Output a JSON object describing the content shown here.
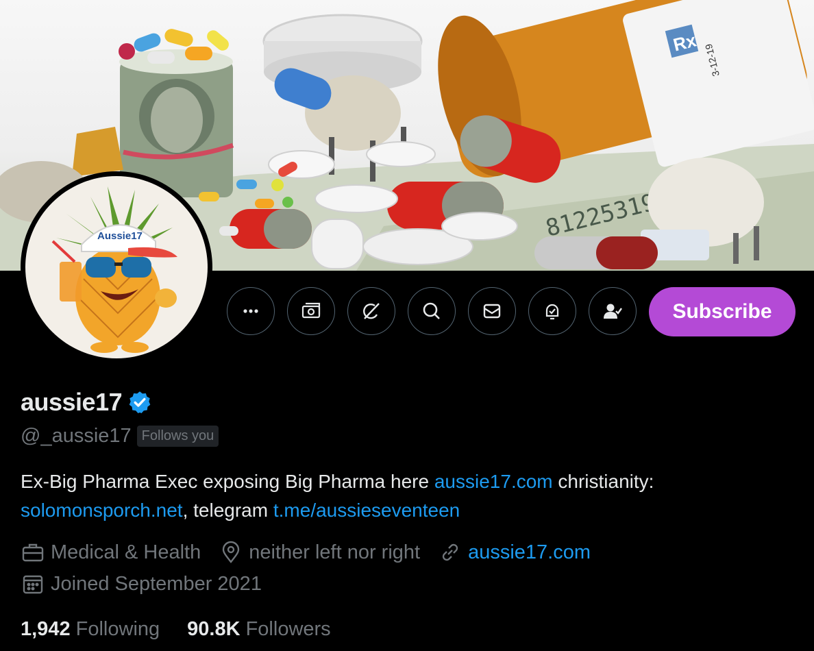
{
  "banner": {
    "label_rx": "Rx",
    "bottle_code": "3-12-19",
    "bill_serial": "81225319"
  },
  "avatar": {
    "cap_text": "Aussie17"
  },
  "actions": {
    "more_icon": "more-icon",
    "money_icon": "money-icon",
    "grok_icon": "grok-icon",
    "search_icon": "search-icon",
    "message_icon": "message-icon",
    "notifications_icon": "bell-icon",
    "following_icon": "person-check-icon",
    "subscribe_label": "Subscribe",
    "subscribe_color": "#b44ad6"
  },
  "profile": {
    "display_name": "aussie17",
    "handle": "@_aussie17",
    "follows_you": "Follows you",
    "bio": {
      "part1": "Ex-Big Pharma Exec exposing Big Pharma here ",
      "link1": "aussie17.com",
      "part2": " christianity:",
      "link2": "solomonsporch.net",
      "part3": ", telegram ",
      "link3": "t.me/aussieseventeen"
    },
    "category": "Medical & Health",
    "location": "neither left nor right",
    "website": "aussie17.com",
    "joined": "Joined September 2021",
    "following_count": "1,942",
    "following_label": "Following",
    "followers_count": "90.8K",
    "followers_label": "Followers"
  },
  "colors": {
    "link": "#1d9bf0",
    "muted": "#71767b",
    "verified": "#1d9bf0"
  }
}
